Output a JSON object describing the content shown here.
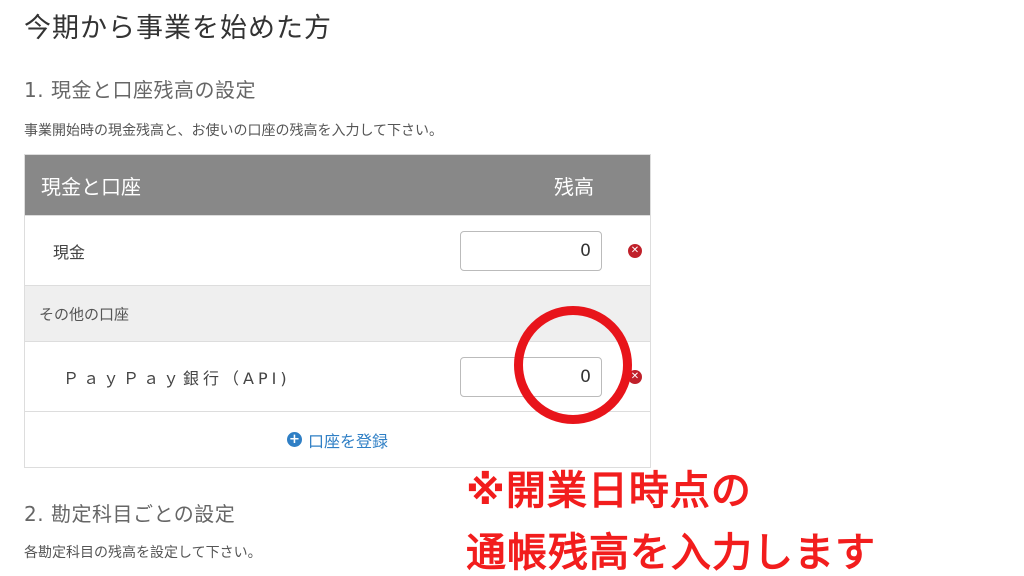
{
  "page": {
    "title": "今期から事業を始めた方"
  },
  "section1": {
    "heading": "1. 現金と口座残高の設定",
    "description": "事業開始時の現金残高と、お使いの口座の残高を入力して下さい。"
  },
  "table": {
    "header_account": "現金と口座",
    "header_balance": "残高",
    "cash_row": {
      "label": "現金",
      "value": "0"
    },
    "other_accounts_label": "その他の口座",
    "bank_row": {
      "label": "ＰａｙＰａｙ銀行（API)",
      "value": "0"
    },
    "add_account_label": "口座を登録"
  },
  "section2": {
    "heading": "2. 勘定科目ごとの設定",
    "description": "各勘定科目の残高を設定して下さい。"
  },
  "annotation": {
    "line1": "※開業日時点の",
    "line2": "通帳残高を入力します",
    "color": "#f21d1d"
  },
  "colors": {
    "header_bg": "#888888",
    "link": "#2f7fc5",
    "delete": "#c0202a"
  }
}
